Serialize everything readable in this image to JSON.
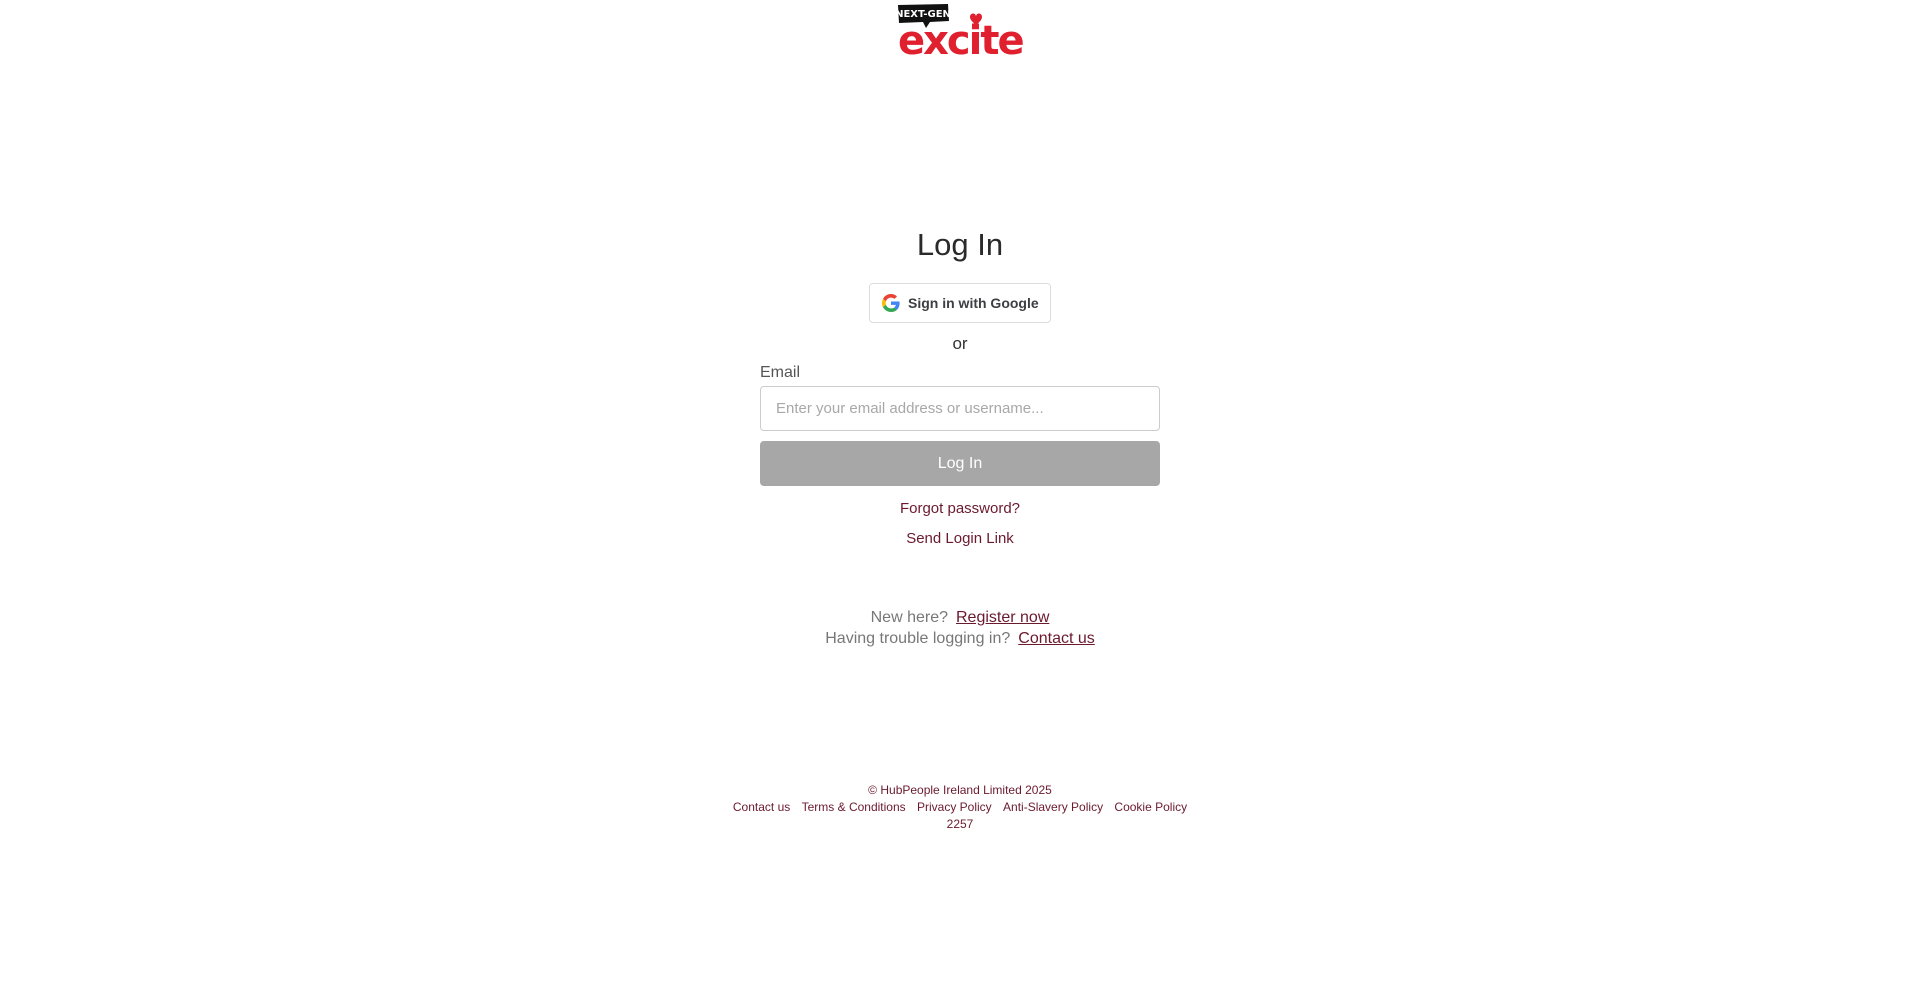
{
  "brand": {
    "badge_text": "NEXT-GEN",
    "logo_text": "excite",
    "brand_color": "#e0202e"
  },
  "login": {
    "title": "Log In",
    "google_label": "Sign in with Google",
    "or_text": "or",
    "email_label": "Email",
    "email_placeholder": "Enter your email address or username...",
    "email_value": "",
    "submit_label": "Log In",
    "forgot_label": "Forgot password?",
    "send_link_label": "Send Login Link"
  },
  "help": {
    "new_here": "New here?",
    "register_label": "Register now",
    "trouble_text": "Having trouble logging in?",
    "contact_label": "Contact us"
  },
  "footer": {
    "copyright": "© HubPeople Ireland Limited  2025",
    "links": [
      "Contact us",
      "Terms & Conditions",
      "Privacy Policy",
      "Anti-Slavery Policy",
      "Cookie Policy"
    ],
    "build_number": "2257"
  },
  "colors": {
    "link": "#6b1a2e",
    "button_disabled": "#a7a7a7",
    "logo_red": "#e0202e"
  }
}
